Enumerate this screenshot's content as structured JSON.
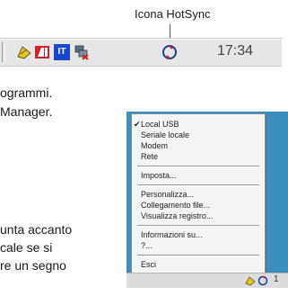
{
  "callout": {
    "label": "Icona HotSync"
  },
  "tray": {
    "icons": [
      "shield-pen-icon",
      "ati-icon",
      "it-icon",
      "network-icon",
      "hotsync-icon"
    ],
    "clock": "17:34",
    "it_text": "IT"
  },
  "body_text": {
    "line1": "ogrammi.",
    "line2": "Manager.",
    "line3": "unta accanto",
    "line4": "cale se si",
    "line5": "re un segno"
  },
  "menu": {
    "items": [
      {
        "label": "Local USB",
        "checked": true
      },
      {
        "label": "Seriale locale"
      },
      {
        "label": "Modem"
      },
      {
        "label": "Rete"
      },
      {
        "label": "Imposta..."
      },
      {
        "label": "Personalizza..."
      },
      {
        "label": "Collegamento file..."
      },
      {
        "label": "Visualizza registro..."
      },
      {
        "label": "Informazioni su..."
      },
      {
        "label": "?..."
      },
      {
        "label": "Esci"
      }
    ]
  },
  "mini_tray": {
    "clock_fragment": "1"
  }
}
